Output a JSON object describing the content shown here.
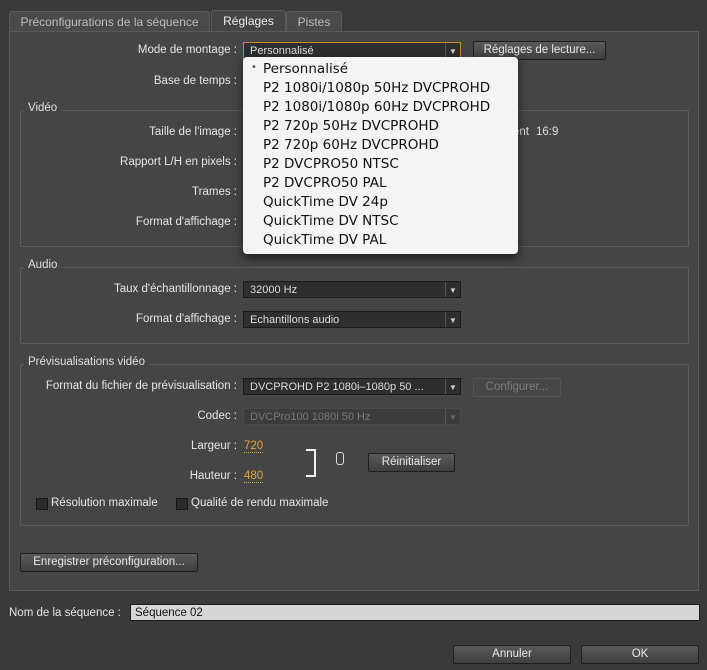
{
  "tabs": [
    "Préconfigurations de la séquence",
    "Réglages",
    "Pistes"
  ],
  "general": {
    "editing_mode_label": "Mode de montage :",
    "editing_mode_value": "Personnalisé",
    "timebase_label": "Base de temps :",
    "playback_settings_button": "Réglages de lecture..."
  },
  "video": {
    "title": "Vidéo",
    "frame_size_label": "Taille de l'image :",
    "aspect_partial": "ement",
    "aspect_value": "16:9",
    "pixel_aspect_label": "Rapport L/H en pixels :",
    "fields_label": "Trames :",
    "display_format_label": "Format d'affichage :"
  },
  "audio": {
    "title": "Audio",
    "sample_rate_label": "Taux d'échantillonnage :",
    "sample_rate_value": "32000 Hz",
    "display_format_label": "Format d'affichage :",
    "display_format_value": "Echantillons audio"
  },
  "preview": {
    "title": "Prévisualisations vidéo",
    "file_format_label": "Format du fichier de prévisualisation :",
    "file_format_value": "DVCPROHD P2 1080i–1080p 50 ...",
    "configure_button": "Configurer...",
    "codec_label": "Codec :",
    "codec_value": "DVCPro100 1080i 50 Hz",
    "width_label": "Largeur :",
    "width_value": "720",
    "height_label": "Hauteur :",
    "height_value": "480",
    "reset_button": "Réinitialiser",
    "max_resolution_label": "Résolution maximale",
    "max_quality_label": "Qualité de rendu maximale"
  },
  "save_preset_button": "Enregistrer préconfiguration...",
  "sequence_name_label": "Nom de la séquence :",
  "sequence_name_value": "Séquence 02",
  "cancel_button": "Annuler",
  "ok_button": "OK",
  "dropdown_menu": {
    "selected_marker": "•",
    "items": [
      "Personnalisé",
      "P2 1080i/1080p 50Hz DVCPROHD",
      "P2 1080i/1080p 60Hz DVCPROHD",
      "P2 720p 50Hz DVCPROHD",
      "P2 720p 60Hz DVCPROHD",
      "P2 DVCPRO50 NTSC",
      "P2 DVCPRO50 PAL",
      "QuickTime DV 24p",
      "QuickTime DV NTSC",
      "QuickTime DV PAL"
    ]
  },
  "icons": {
    "chain": "link-icon",
    "dropdown_arrow": "chevron-down-icon"
  }
}
